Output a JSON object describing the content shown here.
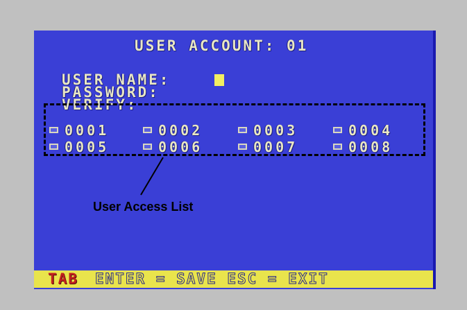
{
  "title": "USER ACCOUNT: 01",
  "fields": {
    "user_name_label": "USER NAME:",
    "password_label": "PASSWORD:",
    "verify_label": "VERIFY:"
  },
  "access_list": [
    [
      "0001",
      "0002",
      "0003",
      "0004"
    ],
    [
      "0005",
      "0006",
      "0007",
      "0008"
    ]
  ],
  "callout": "User Access List",
  "footer": {
    "tab": "TAB",
    "help": "ENTER = SAVE   ESC = EXIT"
  },
  "colors": {
    "screen_bg": "#3a3fd6",
    "text": "#e8e6c4",
    "footer_bg": "#e9e44c",
    "tab_text": "#c0201e",
    "cursor": "#f2ee62"
  }
}
